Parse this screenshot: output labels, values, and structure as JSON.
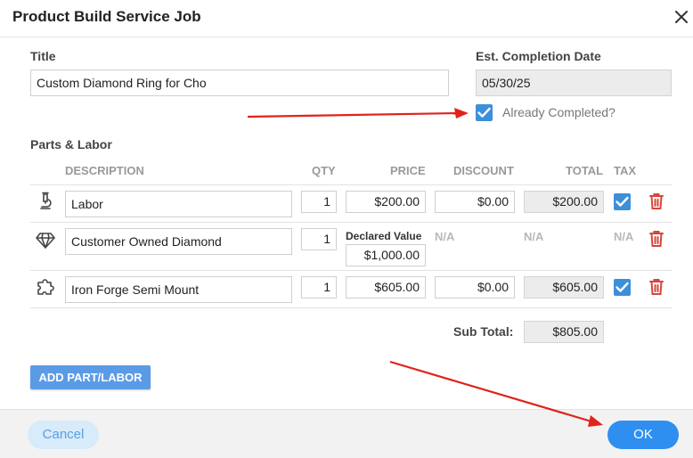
{
  "dialog": {
    "title": "Product Build Service Job",
    "close_icon": "close-icon"
  },
  "form": {
    "title_label": "Title",
    "title_value": "Custom Diamond Ring for Cho",
    "date_label": "Est. Completion Date",
    "date_value": "05/30/25",
    "already_completed_label": "Already Completed?",
    "already_completed_checked": true
  },
  "parts": {
    "section_label": "Parts & Labor",
    "columns": {
      "description": "DESCRIPTION",
      "qty": "QTY",
      "price": "PRICE",
      "discount": "DISCOUNT",
      "total": "TOTAL",
      "tax": "TAX"
    },
    "rows": [
      {
        "icon": "microscope-icon",
        "description": "Labor",
        "qty": "1",
        "price": "$200.00",
        "discount": "$0.00",
        "total": "$200.00",
        "tax_checked": true
      },
      {
        "icon": "diamond-icon",
        "description": "Customer Owned Diamond",
        "qty": "1",
        "declared_label": "Declared Value",
        "declared_value": "$1,000.00",
        "discount": "N/A",
        "total": "N/A",
        "tax": "N/A"
      },
      {
        "icon": "puzzle-icon",
        "description": "Iron Forge Semi Mount",
        "qty": "1",
        "price": "$605.00",
        "discount": "$0.00",
        "total": "$605.00",
        "tax_checked": true
      }
    ],
    "subtotal_label": "Sub Total:",
    "subtotal_value": "$805.00",
    "add_button": "ADD PART/LABOR"
  },
  "footer": {
    "cancel": "Cancel",
    "ok": "OK"
  },
  "colors": {
    "accent": "#2e8ff0",
    "checkbox": "#3d8fd9",
    "delete": "#d9443a",
    "annotation_arrow": "#e0231c"
  }
}
